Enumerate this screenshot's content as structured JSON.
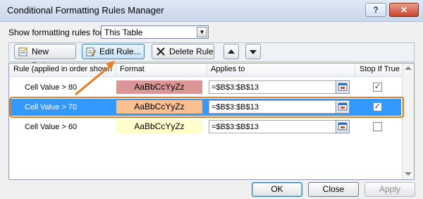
{
  "window": {
    "title": "Conditional Formatting Rules Manager",
    "help_label": "?",
    "close_label": "✕"
  },
  "show_rules": {
    "label": "Show formatting rules for:",
    "value": "This Table"
  },
  "toolbar": {
    "new_label": "New Rule...",
    "edit_label": "Edit Rule...",
    "delete_label": "Delete Rule"
  },
  "columns": {
    "rule": "Rule (applied in order shown)",
    "format": "Format",
    "applies": "Applies to",
    "stop": "Stop If True"
  },
  "rules": [
    {
      "condition": "Cell Value > 80",
      "preview": "AaBbCcYyZz",
      "applies_to": "=$B$3:$B$13",
      "stop_if_true": true,
      "fill": "#d99694",
      "selected": false
    },
    {
      "condition": "Cell Value > 70",
      "preview": "AaBbCcYyZz",
      "applies_to": "=$B$3:$B$13",
      "stop_if_true": true,
      "fill": "#fabf8f",
      "selected": true
    },
    {
      "condition": "Cell Value > 60",
      "preview": "AaBbCcYyZz",
      "applies_to": "=$B$3:$B$13",
      "stop_if_true": false,
      "fill": "#ffffcc",
      "selected": false
    }
  ],
  "footer": {
    "ok": "OK",
    "close": "Close",
    "apply": "Apply"
  },
  "colors": {
    "selection": "#3399ff",
    "highlight": "#e67e22"
  }
}
